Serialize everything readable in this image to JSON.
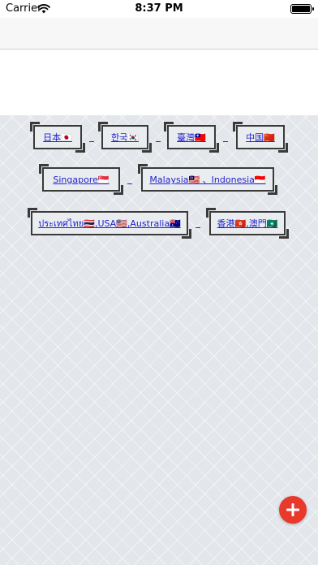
{
  "status_bar": {
    "carrier": "Carrier",
    "time": "8:37 PM"
  },
  "regions": [
    {
      "label": "日本🇯🇵"
    },
    {
      "label": "한국🇰🇷"
    },
    {
      "label": "臺灣🇹🇼"
    },
    {
      "label": "中国🇨🇳"
    },
    {
      "label": "Singapore🇸🇬"
    },
    {
      "label": "Malaysia🇲🇾 、Indonesia🇮🇩"
    },
    {
      "label": "ประเทศไทย🇹🇭,USA🇺🇸,Australia🇦🇺"
    },
    {
      "label": "香港🇭🇰,澳門🇲🇴"
    }
  ],
  "fab": {
    "icon": "plus-icon",
    "color": "#e8392b"
  }
}
